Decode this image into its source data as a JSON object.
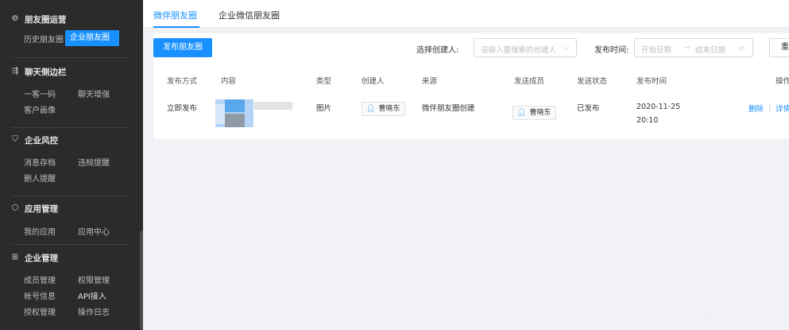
{
  "sidebar": {
    "sections": [
      {
        "title": "朋友圈运营",
        "icon": "gear-icon",
        "items": [
          "历史朋友圈",
          "企业朋友圈"
        ]
      },
      {
        "title": "聊天侧边栏",
        "icon": "sidebar-icon",
        "items": [
          "一客一码",
          "聊天增强",
          "客户画像"
        ]
      },
      {
        "title": "企业风控",
        "icon": "shield-icon",
        "items": [
          "消息存档",
          "违规提醒",
          "删人提醒"
        ]
      },
      {
        "title": "应用管理",
        "icon": "cube-icon",
        "items": [
          "我的应用",
          "应用中心"
        ]
      },
      {
        "title": "企业管理",
        "icon": "building-icon",
        "items": [
          "成员管理",
          "权限管理",
          "帐号信息",
          "API接入",
          "授权管理",
          "操作日志"
        ]
      }
    ]
  },
  "tabs": [
    "微伴朋友圈",
    "企业微信朋友圈"
  ],
  "toolbar": {
    "publish_button": "发布朋友圈",
    "creator_label": "选择创建人:",
    "creator_placeholder": "请输入要搜索的创建人",
    "time_label": "发布时间:",
    "start_placeholder": "开始日期",
    "range_sep": "~",
    "end_placeholder": "结束日期",
    "reset_button": "重"
  },
  "table": {
    "columns": [
      "发布方式",
      "内容",
      "类型",
      "创建人",
      "来源",
      "发送成员",
      "发送状态",
      "发布时间",
      "操作"
    ],
    "rows": [
      {
        "method": "立即发布",
        "type": "图片",
        "creator": "曹晓东",
        "source": "微伴朋友圈创建",
        "member": "曹晓东",
        "status": "已发布",
        "date": "2020-11-25",
        "time": "20:10",
        "actions": [
          "删除",
          "详情"
        ]
      }
    ]
  },
  "watermark": "https://blog.csdn.net/weixin_41536696",
  "colors": {
    "accent": "#1890ff",
    "sidebar_bg": "#2b2b2b"
  }
}
